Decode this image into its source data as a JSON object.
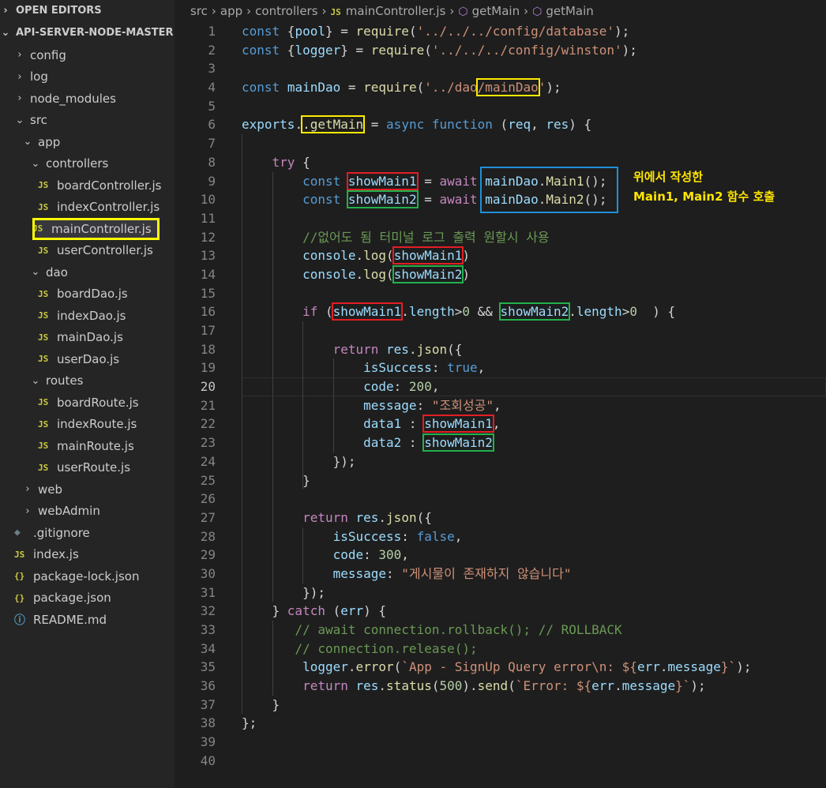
{
  "sidebar": {
    "open_editors": "OPEN EDITORS",
    "project": "API-SERVER-NODE-MASTER",
    "tree": [
      {
        "label": "config",
        "type": "folder",
        "depth": 1,
        "open": false
      },
      {
        "label": "log",
        "type": "folder",
        "depth": 1,
        "open": false
      },
      {
        "label": "node_modules",
        "type": "folder",
        "depth": 1,
        "open": false
      },
      {
        "label": "src",
        "type": "folder",
        "depth": 1,
        "open": true
      },
      {
        "label": "app",
        "type": "folder",
        "depth": 2,
        "open": true
      },
      {
        "label": "controllers",
        "type": "folder",
        "depth": 3,
        "open": true
      },
      {
        "label": "boardController.js",
        "type": "js",
        "depth": 4
      },
      {
        "label": "indexController.js",
        "type": "js",
        "depth": 4
      },
      {
        "label": "mainController.js",
        "type": "js",
        "depth": 4,
        "selected": true
      },
      {
        "label": "userController.js",
        "type": "js",
        "depth": 4
      },
      {
        "label": "dao",
        "type": "folder",
        "depth": 3,
        "open": true
      },
      {
        "label": "boardDao.js",
        "type": "js",
        "depth": 4
      },
      {
        "label": "indexDao.js",
        "type": "js",
        "depth": 4
      },
      {
        "label": "mainDao.js",
        "type": "js",
        "depth": 4
      },
      {
        "label": "userDao.js",
        "type": "js",
        "depth": 4
      },
      {
        "label": "routes",
        "type": "folder",
        "depth": 3,
        "open": true
      },
      {
        "label": "boardRoute.js",
        "type": "js",
        "depth": 4
      },
      {
        "label": "indexRoute.js",
        "type": "js",
        "depth": 4
      },
      {
        "label": "mainRoute.js",
        "type": "js",
        "depth": 4
      },
      {
        "label": "userRoute.js",
        "type": "js",
        "depth": 4
      },
      {
        "label": "web",
        "type": "folder",
        "depth": 2,
        "open": false
      },
      {
        "label": "webAdmin",
        "type": "folder",
        "depth": 2,
        "open": false
      },
      {
        "label": ".gitignore",
        "type": "git",
        "depth": 1
      },
      {
        "label": "index.js",
        "type": "js",
        "depth": 1
      },
      {
        "label": "package-lock.json",
        "type": "json",
        "depth": 1
      },
      {
        "label": "package.json",
        "type": "json",
        "depth": 1
      },
      {
        "label": "README.md",
        "type": "info",
        "depth": 1
      }
    ]
  },
  "breadcrumb": {
    "parts": [
      "src",
      "app",
      "controllers"
    ],
    "file": "mainController.js",
    "symbols": [
      "getMain",
      "getMain"
    ]
  },
  "editor": {
    "current_line": 20,
    "line_numbers": [
      "1",
      "2",
      "3",
      "4",
      "5",
      "6",
      "7",
      "8",
      "9",
      "10",
      "11",
      "12",
      "13",
      "14",
      "15",
      "16",
      "17",
      "18",
      "19",
      "20",
      "21",
      "22",
      "23",
      "24",
      "25",
      "26",
      "27",
      "28",
      "29",
      "30",
      "31",
      "32",
      "33",
      "34",
      "35",
      "36",
      "37",
      "38",
      "39",
      "40"
    ],
    "annotation": [
      "위에서 작성한",
      "Main1, Main2 함수 호출"
    ],
    "lines": [
      [
        [
          "kw",
          "const"
        ],
        [
          "pl",
          " {"
        ],
        [
          "var",
          "pool"
        ],
        [
          "pl",
          "} = "
        ],
        [
          "fn",
          "require"
        ],
        [
          "pl",
          "("
        ],
        [
          "str",
          "'../../../config/database'"
        ],
        [
          "pl",
          ");"
        ]
      ],
      [
        [
          "kw",
          "const"
        ],
        [
          "pl",
          " {"
        ],
        [
          "var",
          "logger"
        ],
        [
          "pl",
          "} = "
        ],
        [
          "fn",
          "require"
        ],
        [
          "pl",
          "("
        ],
        [
          "str",
          "'../../../config/winston'"
        ],
        [
          "pl",
          ");"
        ]
      ],
      [],
      [
        [
          "kw",
          "const"
        ],
        [
          "pl",
          " "
        ],
        [
          "var",
          "mainDao"
        ],
        [
          "pl",
          " = "
        ],
        [
          "fn",
          "require"
        ],
        [
          "pl",
          "("
        ],
        [
          "str",
          "'../dao"
        ],
        [
          "str",
          "/mainDao",
          "yellow"
        ],
        [
          "str",
          "'"
        ],
        [
          "pl",
          ");"
        ]
      ],
      [],
      [
        [
          "var",
          "exports"
        ],
        [
          "pl",
          "."
        ],
        [
          "fn",
          ".getMain",
          "yellow"
        ],
        [
          "pl",
          " = "
        ],
        [
          "kw",
          "async"
        ],
        [
          "pl",
          " "
        ],
        [
          "kw",
          "function"
        ],
        [
          "pl",
          " ("
        ],
        [
          "var",
          "req"
        ],
        [
          "pl",
          ", "
        ],
        [
          "var",
          "res"
        ],
        [
          "pl",
          ") {"
        ]
      ],
      [],
      [
        [
          "pl",
          "    "
        ],
        [
          "ctl",
          "try"
        ],
        [
          "pl",
          " {"
        ]
      ],
      [
        [
          "pl",
          "        "
        ],
        [
          "kw",
          "const"
        ],
        [
          "pl",
          " "
        ],
        [
          "var",
          "showMain1",
          "red"
        ],
        [
          "pl",
          " = "
        ],
        [
          "ctl",
          "await"
        ],
        [
          "pl",
          " "
        ],
        [
          "var",
          "mainDao"
        ],
        [
          "pl",
          "."
        ],
        [
          "fn",
          "Main1"
        ],
        [
          "pl",
          "();"
        ]
      ],
      [
        [
          "pl",
          "        "
        ],
        [
          "kw",
          "const"
        ],
        [
          "pl",
          " "
        ],
        [
          "var",
          "showMain2",
          "green"
        ],
        [
          "pl",
          " = "
        ],
        [
          "ctl",
          "await"
        ],
        [
          "pl",
          " "
        ],
        [
          "var",
          "mainDao"
        ],
        [
          "pl",
          "."
        ],
        [
          "fn",
          "Main2"
        ],
        [
          "pl",
          "();"
        ]
      ],
      [],
      [
        [
          "pl",
          "        "
        ],
        [
          "cm",
          "//없어도 됨 터미널 로그 출력 원할시 사용"
        ]
      ],
      [
        [
          "pl",
          "        "
        ],
        [
          "var",
          "console"
        ],
        [
          "pl",
          "."
        ],
        [
          "fn",
          "log"
        ],
        [
          "pl",
          "("
        ],
        [
          "var",
          "showMain1",
          "red"
        ],
        [
          "pl",
          ")"
        ]
      ],
      [
        [
          "pl",
          "        "
        ],
        [
          "var",
          "console"
        ],
        [
          "pl",
          "."
        ],
        [
          "fn",
          "log"
        ],
        [
          "pl",
          "("
        ],
        [
          "var",
          "showMain2",
          "green"
        ],
        [
          "pl",
          ")"
        ]
      ],
      [],
      [
        [
          "pl",
          "        "
        ],
        [
          "ctl",
          "if"
        ],
        [
          "pl",
          " ("
        ],
        [
          "var",
          "showMain1",
          "red"
        ],
        [
          "pl",
          "."
        ],
        [
          "var",
          "length"
        ],
        [
          "pl",
          ">"
        ],
        [
          "num",
          "0"
        ],
        [
          "pl",
          " && "
        ],
        [
          "var",
          "showMain2",
          "green"
        ],
        [
          "pl",
          "."
        ],
        [
          "var",
          "length"
        ],
        [
          "pl",
          ">"
        ],
        [
          "num",
          "0"
        ],
        [
          "pl",
          "  ) {"
        ]
      ],
      [],
      [
        [
          "pl",
          "            "
        ],
        [
          "ctl",
          "return"
        ],
        [
          "pl",
          " "
        ],
        [
          "var",
          "res"
        ],
        [
          "pl",
          "."
        ],
        [
          "fn",
          "json"
        ],
        [
          "pl",
          "({"
        ]
      ],
      [
        [
          "pl",
          "                "
        ],
        [
          "var",
          "isSuccess"
        ],
        [
          "pl",
          ": "
        ],
        [
          "kw",
          "true"
        ],
        [
          "pl",
          ","
        ]
      ],
      [
        [
          "pl",
          "                "
        ],
        [
          "var",
          "code"
        ],
        [
          "pl",
          ": "
        ],
        [
          "num",
          "200"
        ],
        [
          "pl",
          ","
        ]
      ],
      [
        [
          "pl",
          "                "
        ],
        [
          "var",
          "message"
        ],
        [
          "pl",
          ": "
        ],
        [
          "str",
          "\"조회성공\""
        ],
        [
          "pl",
          ","
        ]
      ],
      [
        [
          "pl",
          "                "
        ],
        [
          "var",
          "data1"
        ],
        [
          "pl",
          " : "
        ],
        [
          "var",
          "showMain1",
          "red"
        ],
        [
          "pl",
          ","
        ]
      ],
      [
        [
          "pl",
          "                "
        ],
        [
          "var",
          "data2"
        ],
        [
          "pl",
          " : "
        ],
        [
          "var",
          "showMain2",
          "green"
        ]
      ],
      [
        [
          "pl",
          "            "
        ],
        [
          "pl",
          "});"
        ]
      ],
      [
        [
          "pl",
          "        }"
        ]
      ],
      [],
      [
        [
          "pl",
          "        "
        ],
        [
          "ctl",
          "return"
        ],
        [
          "pl",
          " "
        ],
        [
          "var",
          "res"
        ],
        [
          "pl",
          "."
        ],
        [
          "fn",
          "json"
        ],
        [
          "pl",
          "({"
        ]
      ],
      [
        [
          "pl",
          "            "
        ],
        [
          "var",
          "isSuccess"
        ],
        [
          "pl",
          ": "
        ],
        [
          "kw",
          "false"
        ],
        [
          "pl",
          ","
        ]
      ],
      [
        [
          "pl",
          "            "
        ],
        [
          "var",
          "code"
        ],
        [
          "pl",
          ": "
        ],
        [
          "num",
          "300"
        ],
        [
          "pl",
          ","
        ]
      ],
      [
        [
          "pl",
          "            "
        ],
        [
          "var",
          "message"
        ],
        [
          "pl",
          ": "
        ],
        [
          "str",
          "\"게시물이 존재하지 않습니다\""
        ]
      ],
      [
        [
          "pl",
          "        });"
        ]
      ],
      [
        [
          "pl",
          "    } "
        ],
        [
          "ctl",
          "catch"
        ],
        [
          "pl",
          " ("
        ],
        [
          "var",
          "err"
        ],
        [
          "pl",
          ") {"
        ]
      ],
      [
        [
          "pl",
          "       "
        ],
        [
          "cm",
          "// await connection.rollback(); // ROLLBACK"
        ]
      ],
      [
        [
          "pl",
          "       "
        ],
        [
          "cm",
          "// connection.release();"
        ]
      ],
      [
        [
          "pl",
          "        "
        ],
        [
          "var",
          "logger"
        ],
        [
          "pl",
          "."
        ],
        [
          "fn",
          "error"
        ],
        [
          "pl",
          "("
        ],
        [
          "str",
          "`App - SignUp Query error\\n: ${"
        ],
        [
          "var",
          "err"
        ],
        [
          "pl",
          "."
        ],
        [
          "var",
          "message"
        ],
        [
          "str",
          "}`"
        ],
        [
          "pl",
          ");"
        ]
      ],
      [
        [
          "pl",
          "        "
        ],
        [
          "ctl",
          "return"
        ],
        [
          "pl",
          " "
        ],
        [
          "var",
          "res"
        ],
        [
          "pl",
          "."
        ],
        [
          "fn",
          "status"
        ],
        [
          "pl",
          "("
        ],
        [
          "num",
          "500"
        ],
        [
          "pl",
          ")."
        ],
        [
          "fn",
          "send"
        ],
        [
          "pl",
          "("
        ],
        [
          "str",
          "`Error: ${"
        ],
        [
          "var",
          "err"
        ],
        [
          "pl",
          "."
        ],
        [
          "var",
          "message"
        ],
        [
          "str",
          "}`"
        ],
        [
          "pl",
          ");"
        ]
      ],
      [
        [
          "pl",
          "    }"
        ]
      ],
      [
        [
          "pl",
          "};"
        ]
      ],
      [],
      []
    ]
  }
}
